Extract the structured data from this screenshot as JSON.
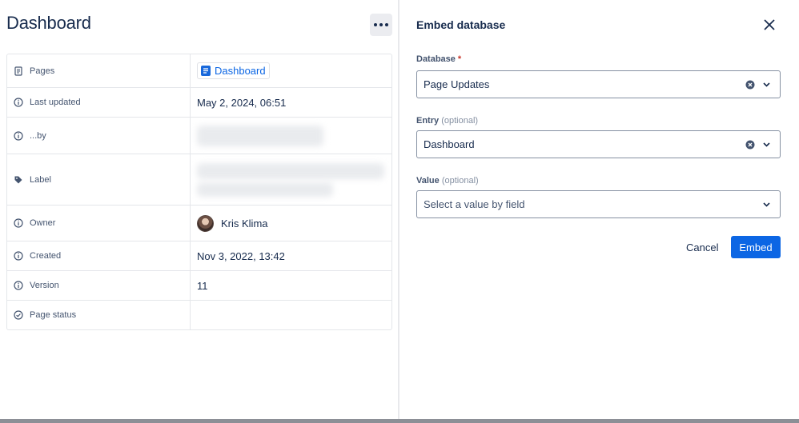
{
  "left": {
    "title": "Dashboard",
    "more_icon": "more-horizontal-icon",
    "properties": [
      {
        "key": "Pages",
        "icon": "page-icon",
        "value": "Dashboard",
        "kind": "page-chip"
      },
      {
        "key": "Last updated",
        "icon": "info-icon",
        "value": "May 2, 2024, 06:51",
        "kind": "text"
      },
      {
        "key": "...by",
        "icon": "info-icon",
        "value": "",
        "kind": "blurred"
      },
      {
        "key": "Label",
        "icon": "tag-icon",
        "value": "",
        "kind": "blurred-multiline"
      },
      {
        "key": "Owner",
        "icon": "info-icon",
        "value": "Kris Klima",
        "kind": "user"
      },
      {
        "key": "Created",
        "icon": "info-icon",
        "value": "Nov 3, 2022, 13:42",
        "kind": "text"
      },
      {
        "key": "Version",
        "icon": "info-icon",
        "value": "11",
        "kind": "text"
      },
      {
        "key": "Page status",
        "icon": "check-circle-icon",
        "value": "",
        "kind": "text"
      }
    ]
  },
  "modal": {
    "title": "Embed database",
    "close_icon": "close-icon",
    "fields": {
      "database": {
        "label": "Database",
        "required_marker": "*",
        "value": "Page Updates"
      },
      "entry": {
        "label": "Entry",
        "optional": "(optional)",
        "value": "Dashboard"
      },
      "value": {
        "label": "Value",
        "optional": "(optional)",
        "placeholder": "Select a value by field"
      }
    },
    "cancel_label": "Cancel",
    "embed_label": "Embed",
    "accent_color": "#0c66e4"
  }
}
